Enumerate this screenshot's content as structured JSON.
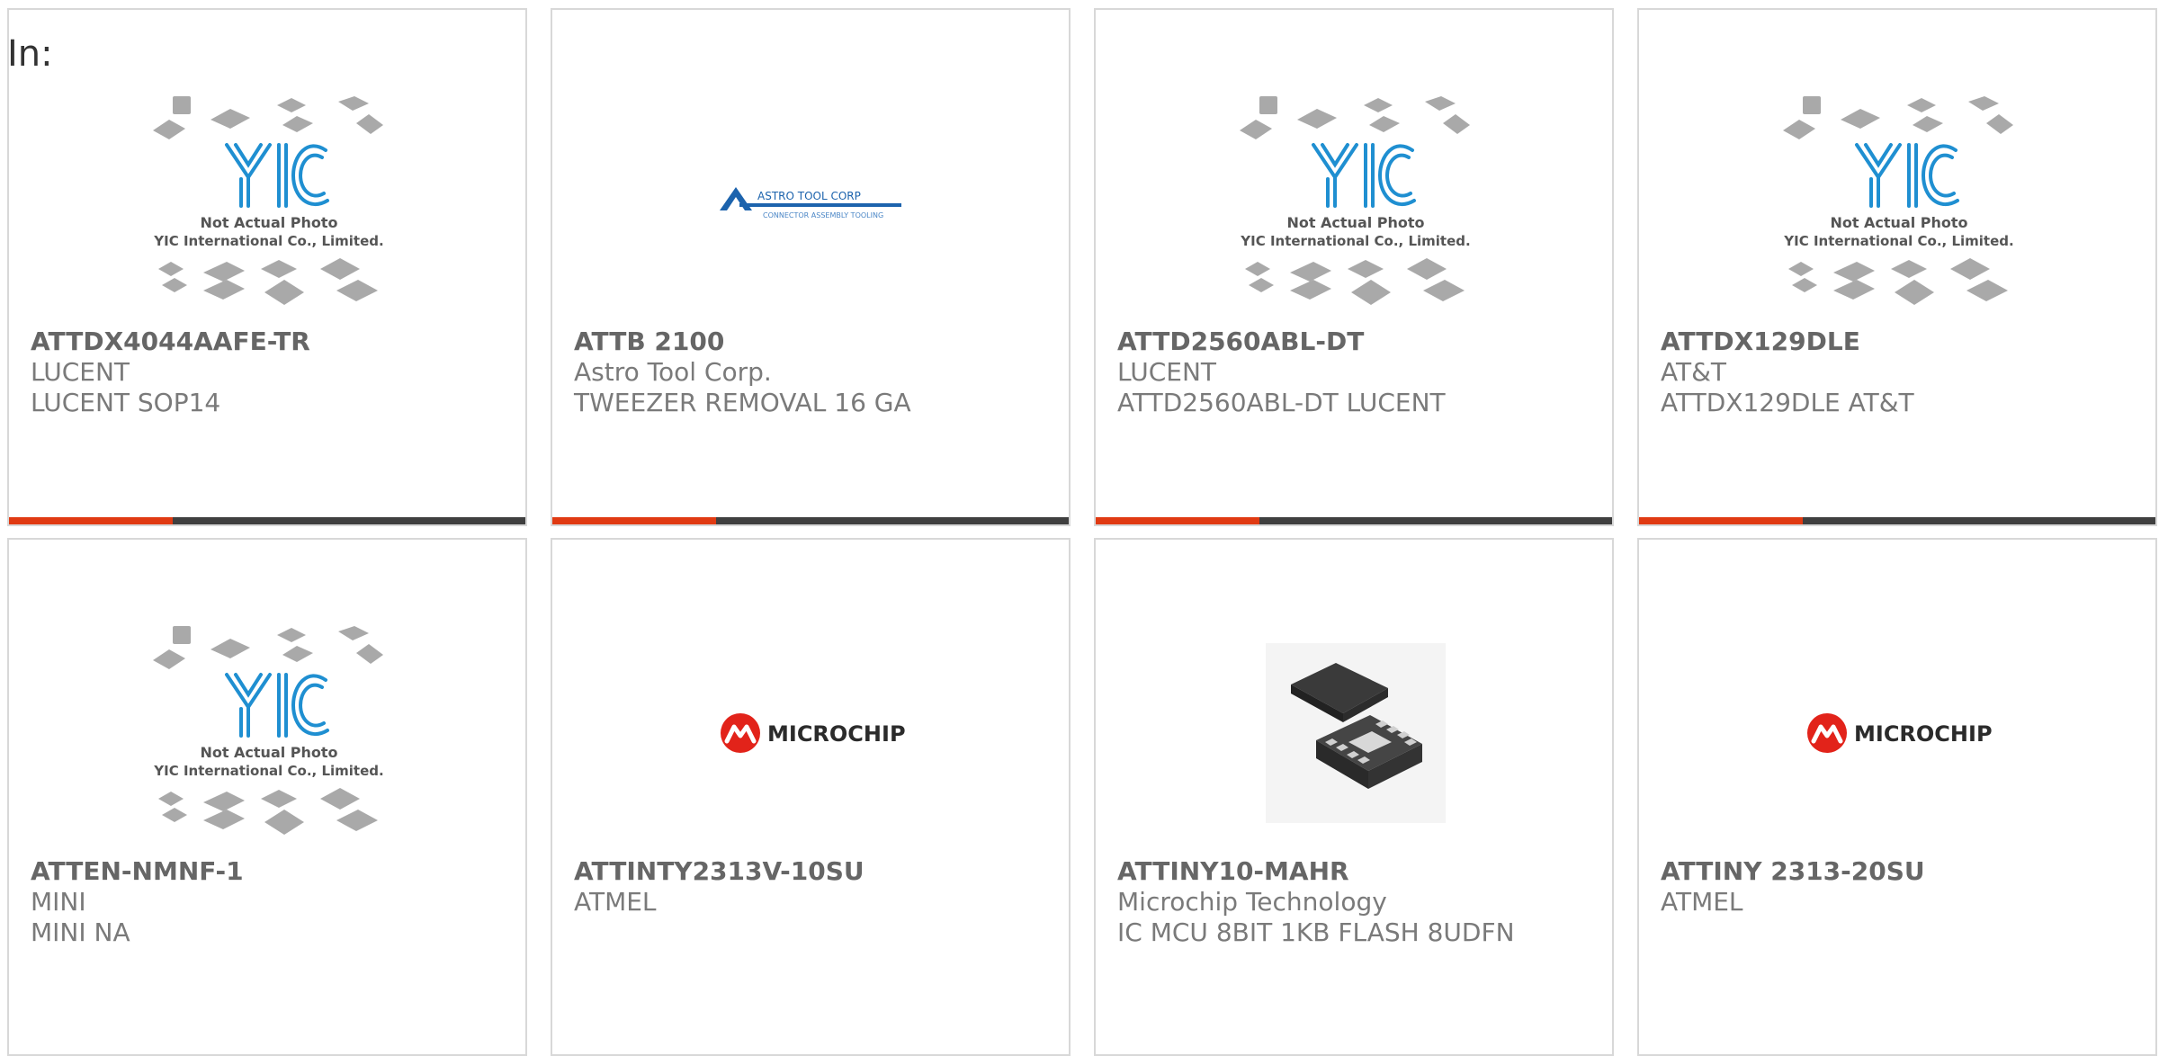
{
  "page": {
    "label": "In:"
  },
  "placeholder_image": {
    "line1": "Not Actual Photo",
    "line2": "YIC International Co., Limited."
  },
  "brands": {
    "astro": "ASTRO TOOL CORP",
    "astro_sub": "CONNECTOR ASSEMBLY TOOLING",
    "microchip": "MICROCHIP"
  },
  "colors": {
    "accent": "#e03a12",
    "bar": "#3f3f3f",
    "yic_blue": "#1f8fd1",
    "microchip_red": "#e2231a"
  },
  "products": [
    {
      "part_number": "ATTDX4044AAFE-TR",
      "manufacturer": "LUCENT",
      "description": "LUCENT SOP14",
      "image": "yic-placeholder"
    },
    {
      "part_number": "ATTB 2100",
      "manufacturer": "Astro Tool Corp.",
      "description": "TWEEZER REMOVAL 16 GA",
      "image": "astro-logo"
    },
    {
      "part_number": "ATTD2560ABL-DT",
      "manufacturer": "LUCENT",
      "description": "ATTD2560ABL-DT LUCENT",
      "image": "yic-placeholder"
    },
    {
      "part_number": "ATTDX129DLE",
      "manufacturer": "AT&T",
      "description": "ATTDX129DLE AT&T",
      "image": "yic-placeholder"
    },
    {
      "part_number": "ATTEN-NMNF-1",
      "manufacturer": "MINI",
      "description": "MINI NA",
      "image": "yic-placeholder"
    },
    {
      "part_number": "ATTINTY2313V-10SU",
      "manufacturer": "ATMEL",
      "description": "",
      "image": "microchip-logo"
    },
    {
      "part_number": "ATTINY10-MAHR",
      "manufacturer": "Microchip Technology",
      "description": "IC MCU 8BIT 1KB FLASH 8UDFN",
      "image": "udfn-chip-photo"
    },
    {
      "part_number": "ATTINY 2313-20SU",
      "manufacturer": "ATMEL",
      "description": "",
      "image": "microchip-logo"
    }
  ]
}
